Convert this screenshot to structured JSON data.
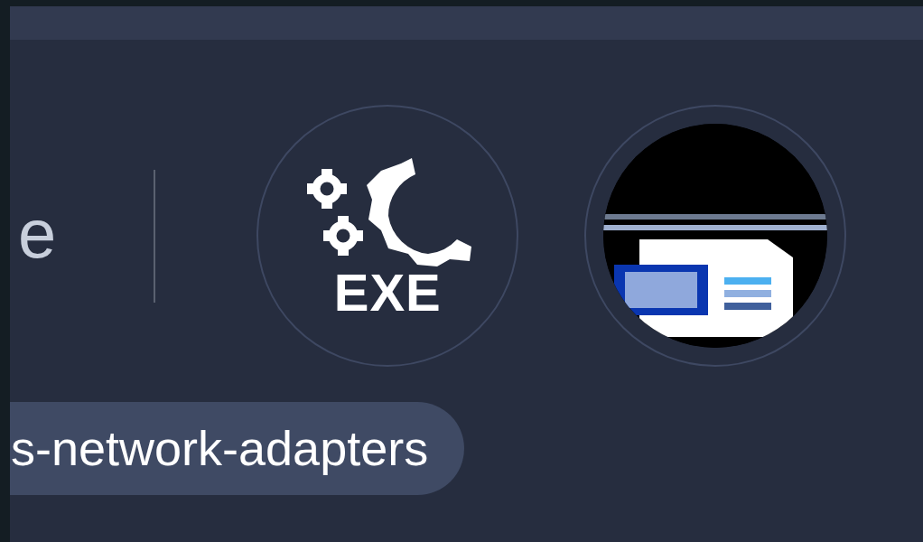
{
  "heading_fragment": "e",
  "apps": [
    {
      "kind": "exe",
      "label": "EXE"
    },
    {
      "kind": "thumbnail"
    }
  ],
  "tag": {
    "label": "s-network-adapters"
  }
}
